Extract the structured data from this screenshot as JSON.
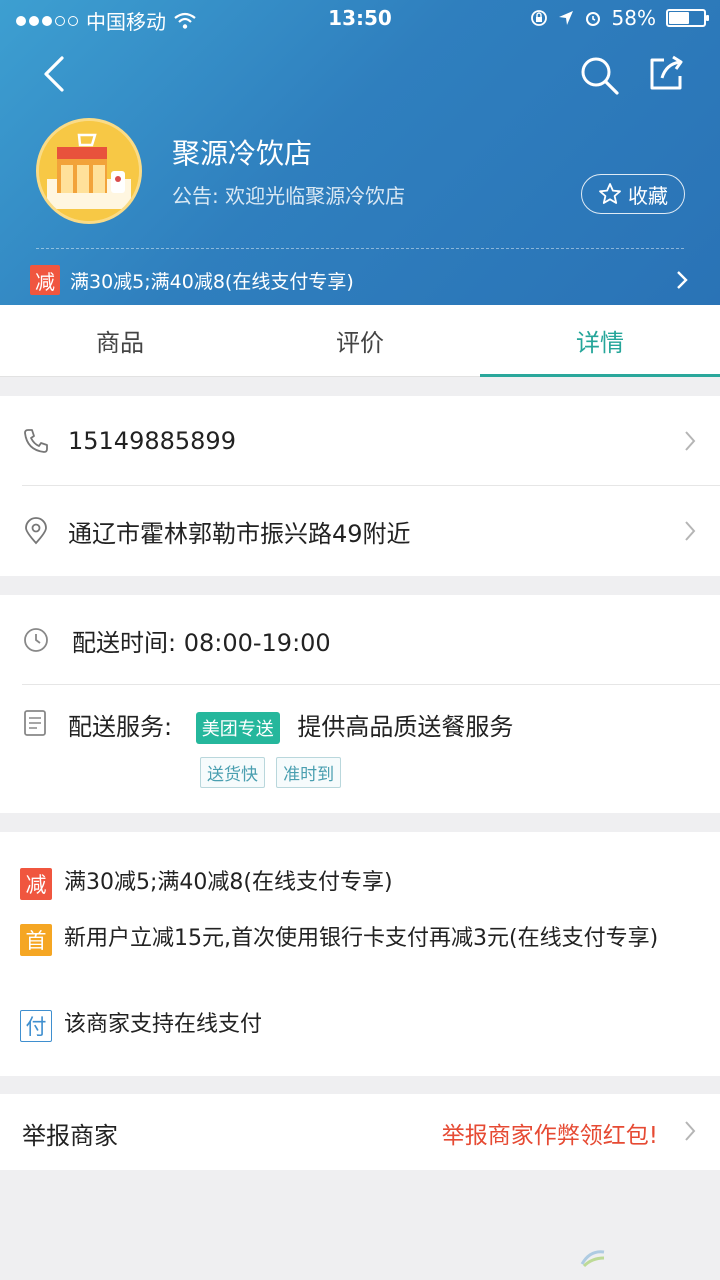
{
  "status_bar": {
    "carrier": "中国移动",
    "time": "13:50",
    "battery": "58%",
    "battery_level": 0.58
  },
  "icons": {
    "back": "chevron-left-icon",
    "search": "search-icon",
    "share": "share-icon",
    "star": "star-icon",
    "phone": "phone-icon",
    "location": "location-pin-icon",
    "clock": "clock-icon",
    "document": "document-icon"
  },
  "shop": {
    "name": "聚源冷饮店",
    "notice": "公告: 欢迎光临聚源冷饮店",
    "favorite_label": "收藏"
  },
  "header_promo": {
    "badge": "减",
    "text": "满30减5;满40减8(在线支付专享)"
  },
  "tabs": [
    {
      "label": "商品",
      "active": false
    },
    {
      "label": "评价",
      "active": false
    },
    {
      "label": "详情",
      "active": true
    }
  ],
  "contact": {
    "phone": "15149885899",
    "address": "通辽市霍林郭勒市振兴路49附近"
  },
  "delivery": {
    "time_text": "配送时间: 08:00-19:00",
    "service_label": "配送服务:",
    "service_tag": "美团专送",
    "service_desc": "提供高品质送餐服务",
    "tags": [
      "送货快",
      "准时到"
    ]
  },
  "promotions": [
    {
      "badge": "减",
      "text": "满30减5;满40减8(在线支付专享)",
      "color": "#f0563f"
    },
    {
      "badge": "首",
      "text": "新用户立减15元,首次使用银行卡支付再减3元(在线支付专享)",
      "color": "#f5a623"
    },
    {
      "badge": "付",
      "text": "该商家支持在线支付",
      "color": "#3f8fcf"
    }
  ],
  "report": {
    "label": "举报商家",
    "hint": "举报商家作弊领红包!"
  },
  "colors": {
    "header_blue": "#2f7fbe",
    "accent_teal": "#26a69a",
    "alert_red": "#e64a33"
  }
}
